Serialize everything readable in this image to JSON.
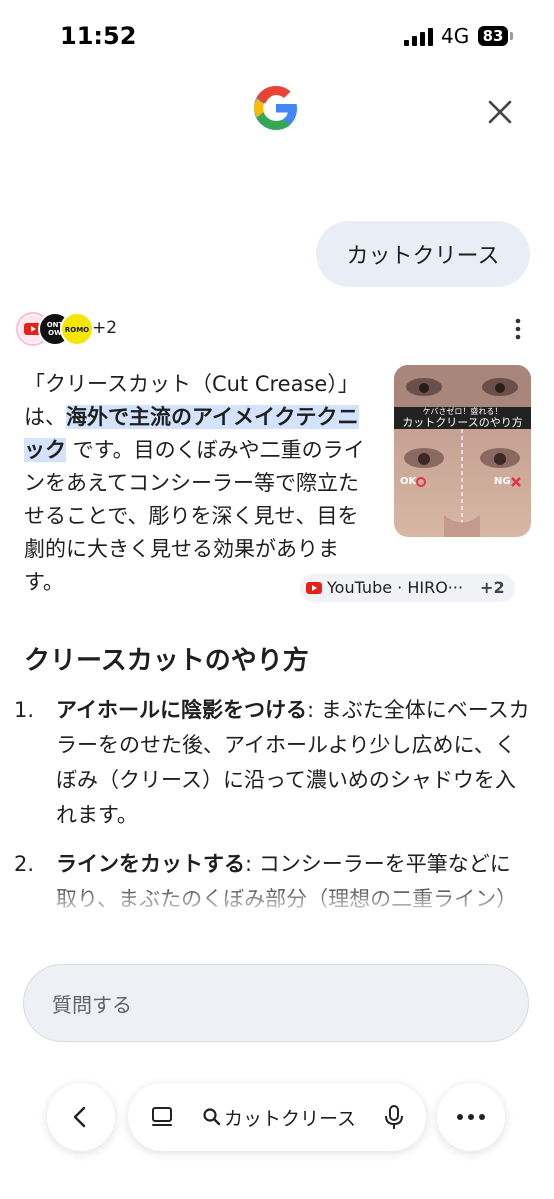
{
  "status_bar": {
    "time": "11:52",
    "network": "4G",
    "battery": "83"
  },
  "header": {
    "logo_icon": "google-g-logo",
    "close_icon": "close-icon"
  },
  "user_query": "カットクリース",
  "sources": {
    "count_label": "+2",
    "icons": [
      "youtube-icon",
      "dontow-icon",
      "beauty-channel-icon"
    ]
  },
  "answer": {
    "text_before": "「クリースカット（Cut Crease）」は、",
    "highlight": "海外で主流のアイメイクテクニック",
    "text_after": " です。目のくぼみや二重のラインをあえてコンシーラー等で際立たせることで、彫りを深く見せ、目を劇的に大きく見せる効果があります。",
    "chip_label": "YouTube · HIRO···",
    "chip_count": "+2"
  },
  "thumbnail": {
    "banner_top": "ケバさゼロ！盛れる！",
    "banner_main": "カットクリースのやり方",
    "ok_label": "OK",
    "ng_label": "NG"
  },
  "section_heading": "クリースカットのやり方",
  "steps": [
    {
      "num": "1.",
      "title": "アイホールに陰影をつける",
      "text": ": まぶた全体にベースカラーをのせた後、アイホールより少し広めに、くぼみ（クリース）に沿って濃いめのシャドウを入れます。"
    },
    {
      "num": "2.",
      "title": "ラインをカットする",
      "text": ": コンシーラーを平筆などに取り、まぶたのくぼみ部分（理想の二重ライン）"
    }
  ],
  "input": {
    "placeholder": "質問する"
  },
  "bottom_nav": {
    "search_label": "カットクリース"
  },
  "colors": {
    "highlight": "#d3e3fd",
    "bubble": "#e9eef6",
    "youtube": "#e62117"
  }
}
